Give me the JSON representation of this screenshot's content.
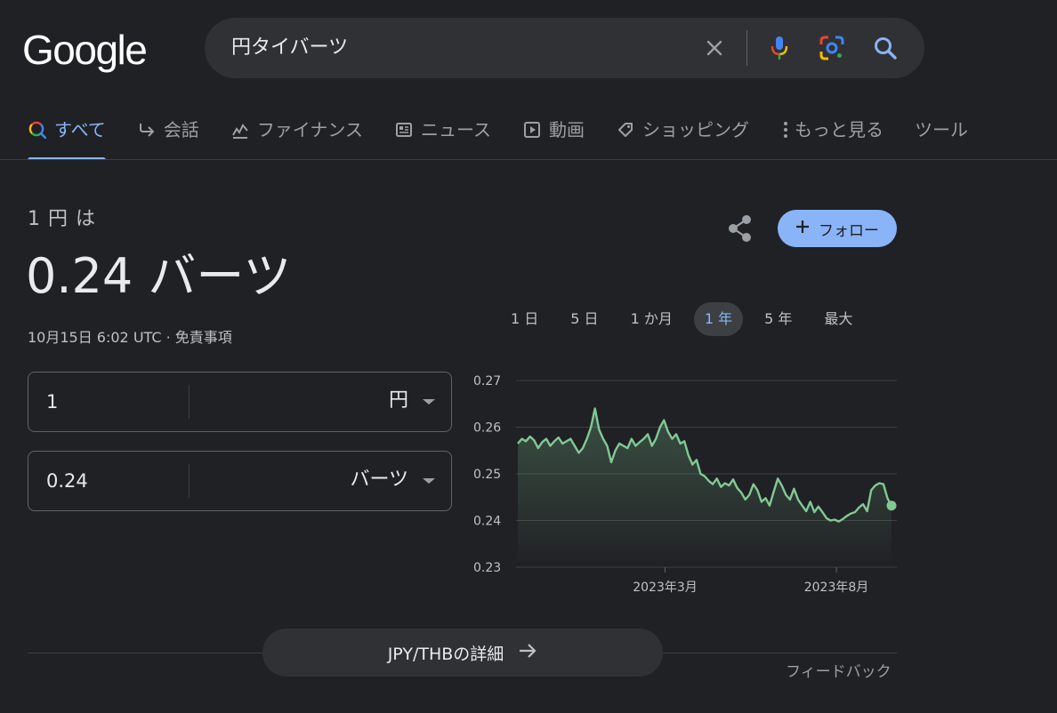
{
  "header": {
    "logo_text": "Google",
    "query": "円タイバーツ",
    "icons": [
      "close-icon",
      "mic-icon",
      "lens-icon",
      "search-icon"
    ]
  },
  "tabs": [
    {
      "label": "すべて",
      "icon": "search-icon",
      "active": true
    },
    {
      "label": "会話",
      "icon": "reply-arrow-icon"
    },
    {
      "label": "ファイナンス",
      "icon": "finance-chart-icon"
    },
    {
      "label": "ニュース",
      "icon": "news-icon"
    },
    {
      "label": "動画",
      "icon": "play-icon"
    },
    {
      "label": "ショッピング",
      "icon": "tag-icon"
    },
    {
      "label": "もっと見る",
      "icon": "more-vert-icon"
    },
    {
      "label": "ツール"
    }
  ],
  "converter": {
    "from_label": "1 円 は",
    "result": "0.24 バーツ",
    "timestamp": "10月15日 6:02 UTC · 免責事項",
    "from_amount": "1",
    "from_currency": "円",
    "to_amount": "0.24",
    "to_currency": "バーツ"
  },
  "actions": {
    "follow_label": "フォロー",
    "follow_color": "#8ab4f8"
  },
  "ranges": [
    "1 日",
    "5 日",
    "1 か月",
    "1 年",
    "5 年",
    "最大"
  ],
  "selected_range": "1 年",
  "chart_data": {
    "type": "area",
    "title": "",
    "xlabel": "",
    "ylabel": "",
    "ylim": [
      0.23,
      0.27
    ],
    "yticks": [
      0.27,
      0.26,
      0.25,
      0.24,
      0.23
    ],
    "ytick_labels": [
      "0.27",
      "0.26",
      "0.25",
      "0.24",
      "0.23"
    ],
    "xtick_labels": [
      "2023年3月",
      "2023年8月"
    ],
    "x_range": [
      "2022年10月",
      "2023年10月"
    ],
    "xtick_positions_month_index": [
      4.5,
      10
    ],
    "line_color": "#81c995",
    "grid": true,
    "series": [
      {
        "values": [
          0.2565,
          0.2575,
          0.257,
          0.258,
          0.2572,
          0.2555,
          0.2568,
          0.2575,
          0.256,
          0.257,
          0.2578,
          0.2565,
          0.257,
          0.2575,
          0.256,
          0.2545,
          0.2555,
          0.2575,
          0.26,
          0.264,
          0.2595,
          0.2575,
          0.256,
          0.2525,
          0.255,
          0.2565,
          0.256,
          0.2555,
          0.2575,
          0.256,
          0.2568,
          0.2575,
          0.2585,
          0.256,
          0.2575,
          0.26,
          0.2615,
          0.259,
          0.2575,
          0.2585,
          0.2565,
          0.257,
          0.254,
          0.252,
          0.253,
          0.25,
          0.2495,
          0.2485,
          0.2478,
          0.249,
          0.2472,
          0.248,
          0.2475,
          0.2488,
          0.247,
          0.246,
          0.2445,
          0.2455,
          0.2478,
          0.2465,
          0.244,
          0.2448,
          0.2432,
          0.2462,
          0.249,
          0.2475,
          0.2455,
          0.2445,
          0.2468,
          0.2445,
          0.2432,
          0.242,
          0.244,
          0.2418,
          0.243,
          0.2418,
          0.2405,
          0.24,
          0.2402,
          0.2398,
          0.2403,
          0.241,
          0.2415,
          0.2418,
          0.2428,
          0.2435,
          0.242,
          0.2465,
          0.2475,
          0.248,
          0.2478,
          0.2448,
          0.2432
        ]
      }
    ],
    "end_point_value": 0.2432
  },
  "footer": {
    "details_label": "JPY/THBの詳細",
    "feedback": "フィードバック"
  }
}
